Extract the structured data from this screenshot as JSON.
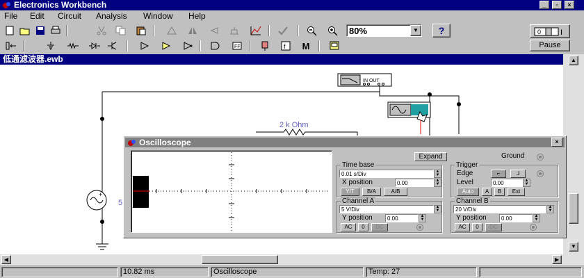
{
  "app": {
    "title": "Electronics Workbench"
  },
  "menu": {
    "file": "File",
    "edit": "Edit",
    "circuit": "Circuit",
    "analysis": "Analysis",
    "window": "Window",
    "help": "Help"
  },
  "toolbar": {
    "zoom": "80%",
    "help": "?",
    "pause": "Pause",
    "logic": "M"
  },
  "document": {
    "title": "低通滤波器.ewb"
  },
  "circuit": {
    "resistor_label": "2 k Ohm",
    "source_value": "5"
  },
  "oscilloscope": {
    "title": "Oscilloscope",
    "expand": "Expand",
    "ground": "Ground",
    "timebase": {
      "label": "Time base",
      "value": "0.01 s/Div",
      "xpos_label": "X position",
      "xpos_value": "0.00",
      "modes": [
        "Y/T",
        "B/A",
        "A/B"
      ]
    },
    "trigger": {
      "label": "Trigger",
      "edge": "Edge",
      "level": "Level",
      "level_value": "0.00",
      "sources": [
        "Auto",
        "A",
        "B",
        "Ext"
      ]
    },
    "channel_a": {
      "label": "Channel A",
      "value": "5 V/Div",
      "ypos_label": "Y position",
      "ypos_value": "0.00",
      "coupling": [
        "AC",
        "0",
        "DC"
      ]
    },
    "channel_b": {
      "label": "Channel B",
      "value": "20 V/Div",
      "ypos_label": "Y position",
      "ypos_value": "0.00",
      "coupling": [
        "AC",
        "0",
        "DC"
      ]
    }
  },
  "status": {
    "time": "10.82 ms",
    "mode": "Oscilloscope",
    "temp": "Temp:  27"
  }
}
